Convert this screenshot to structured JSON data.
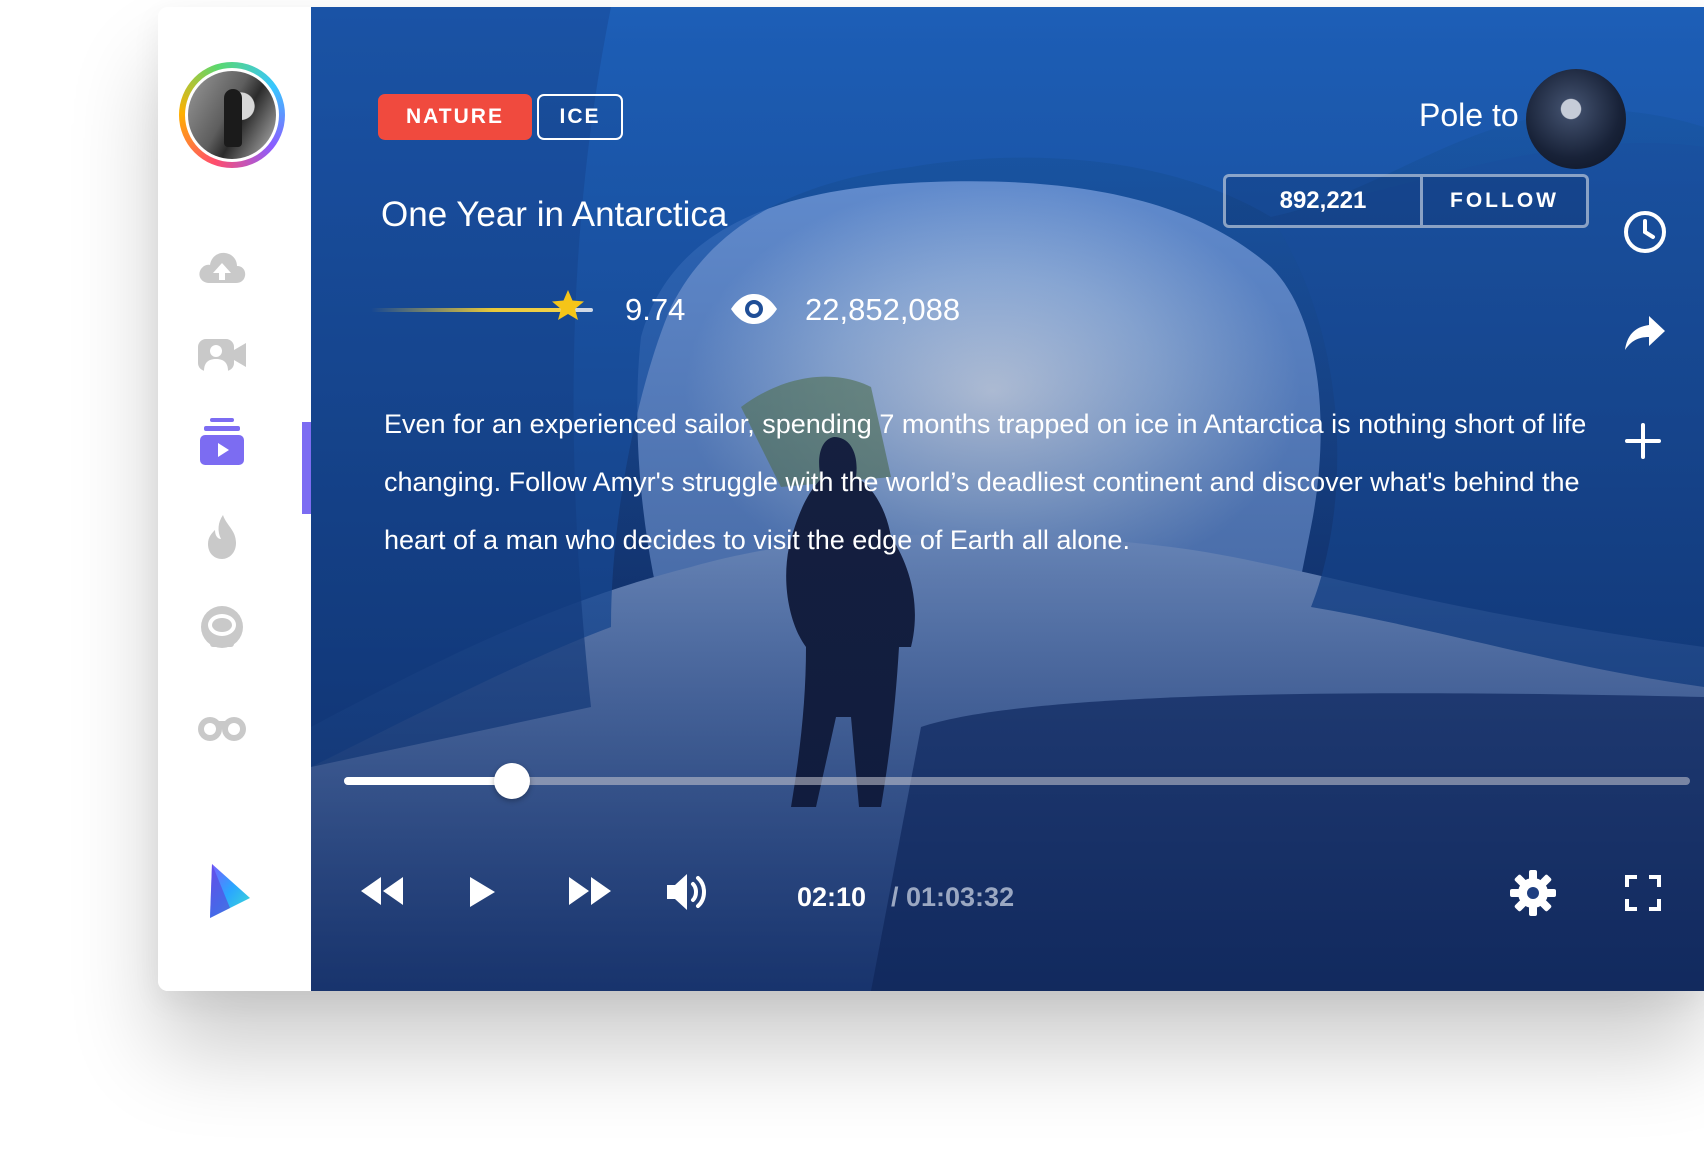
{
  "tags": [
    {
      "label": "NATURE",
      "color": "#f04a3e"
    },
    {
      "label": "ICE"
    }
  ],
  "video": {
    "title": "One Year in Antarctica",
    "rating": "9.74",
    "rating_fraction": 0.974,
    "views": "22,852,088",
    "description": "Even for an experienced sailor, spending 7 months trapped on ice in Antarctica is nothing short of life changing. Follow Amyr's struggle with the world’s deadliest continent and discover what's behind the heart of a man who decides to visit the edge of Earth all alone."
  },
  "channel": {
    "name": "Pole to Pole",
    "followers": "892,221",
    "follow_label": "FOLLOW"
  },
  "player": {
    "current_time": "02:10",
    "total_time": "/ 01:03:32",
    "progress_fraction": 0.125
  },
  "sidebar": {
    "items": [
      {
        "icon": "cloud-upload-icon"
      },
      {
        "icon": "video-camera-icon"
      },
      {
        "icon": "playlist-play-icon",
        "active": true
      },
      {
        "icon": "flame-icon"
      },
      {
        "icon": "astronaut-helmet-icon"
      },
      {
        "icon": "binoculars-icon"
      }
    ],
    "accent_color": "#7c6cf2"
  },
  "side_actions": [
    {
      "icon": "clock-icon"
    },
    {
      "icon": "share-icon"
    },
    {
      "icon": "plus-icon"
    }
  ],
  "controls": [
    {
      "icon": "rewind-icon"
    },
    {
      "icon": "play-icon"
    },
    {
      "icon": "fast-forward-icon"
    },
    {
      "icon": "volume-icon"
    },
    {
      "icon": "settings-icon"
    },
    {
      "icon": "fullscreen-icon"
    }
  ]
}
